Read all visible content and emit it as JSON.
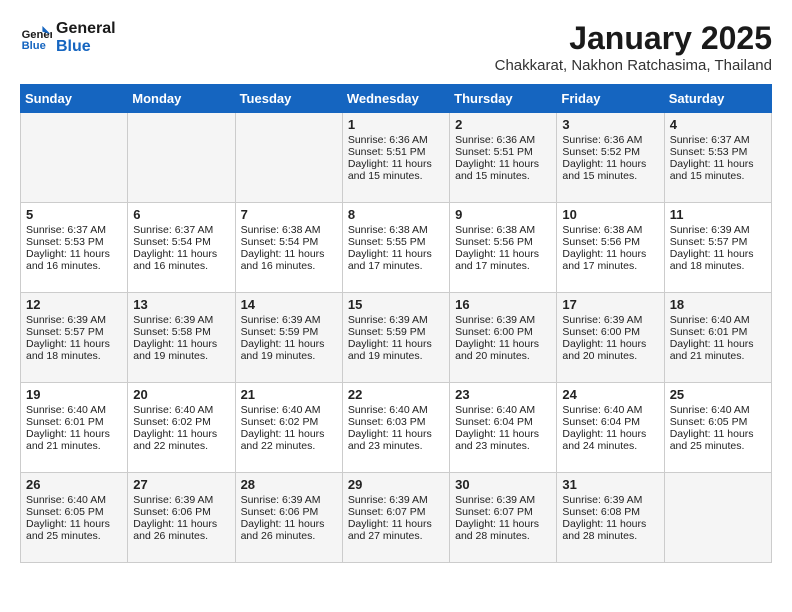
{
  "header": {
    "logo_line1": "General",
    "logo_line2": "Blue",
    "month": "January 2025",
    "location": "Chakkarat, Nakhon Ratchasima, Thailand"
  },
  "days_of_week": [
    "Sunday",
    "Monday",
    "Tuesday",
    "Wednesday",
    "Thursday",
    "Friday",
    "Saturday"
  ],
  "weeks": [
    [
      {
        "day": "",
        "info": ""
      },
      {
        "day": "",
        "info": ""
      },
      {
        "day": "",
        "info": ""
      },
      {
        "day": "1",
        "info": "Sunrise: 6:36 AM\nSunset: 5:51 PM\nDaylight: 11 hours and 15 minutes."
      },
      {
        "day": "2",
        "info": "Sunrise: 6:36 AM\nSunset: 5:51 PM\nDaylight: 11 hours and 15 minutes."
      },
      {
        "day": "3",
        "info": "Sunrise: 6:36 AM\nSunset: 5:52 PM\nDaylight: 11 hours and 15 minutes."
      },
      {
        "day": "4",
        "info": "Sunrise: 6:37 AM\nSunset: 5:53 PM\nDaylight: 11 hours and 15 minutes."
      }
    ],
    [
      {
        "day": "5",
        "info": "Sunrise: 6:37 AM\nSunset: 5:53 PM\nDaylight: 11 hours and 16 minutes."
      },
      {
        "day": "6",
        "info": "Sunrise: 6:37 AM\nSunset: 5:54 PM\nDaylight: 11 hours and 16 minutes."
      },
      {
        "day": "7",
        "info": "Sunrise: 6:38 AM\nSunset: 5:54 PM\nDaylight: 11 hours and 16 minutes."
      },
      {
        "day": "8",
        "info": "Sunrise: 6:38 AM\nSunset: 5:55 PM\nDaylight: 11 hours and 17 minutes."
      },
      {
        "day": "9",
        "info": "Sunrise: 6:38 AM\nSunset: 5:56 PM\nDaylight: 11 hours and 17 minutes."
      },
      {
        "day": "10",
        "info": "Sunrise: 6:38 AM\nSunset: 5:56 PM\nDaylight: 11 hours and 17 minutes."
      },
      {
        "day": "11",
        "info": "Sunrise: 6:39 AM\nSunset: 5:57 PM\nDaylight: 11 hours and 18 minutes."
      }
    ],
    [
      {
        "day": "12",
        "info": "Sunrise: 6:39 AM\nSunset: 5:57 PM\nDaylight: 11 hours and 18 minutes."
      },
      {
        "day": "13",
        "info": "Sunrise: 6:39 AM\nSunset: 5:58 PM\nDaylight: 11 hours and 19 minutes."
      },
      {
        "day": "14",
        "info": "Sunrise: 6:39 AM\nSunset: 5:59 PM\nDaylight: 11 hours and 19 minutes."
      },
      {
        "day": "15",
        "info": "Sunrise: 6:39 AM\nSunset: 5:59 PM\nDaylight: 11 hours and 19 minutes."
      },
      {
        "day": "16",
        "info": "Sunrise: 6:39 AM\nSunset: 6:00 PM\nDaylight: 11 hours and 20 minutes."
      },
      {
        "day": "17",
        "info": "Sunrise: 6:39 AM\nSunset: 6:00 PM\nDaylight: 11 hours and 20 minutes."
      },
      {
        "day": "18",
        "info": "Sunrise: 6:40 AM\nSunset: 6:01 PM\nDaylight: 11 hours and 21 minutes."
      }
    ],
    [
      {
        "day": "19",
        "info": "Sunrise: 6:40 AM\nSunset: 6:01 PM\nDaylight: 11 hours and 21 minutes."
      },
      {
        "day": "20",
        "info": "Sunrise: 6:40 AM\nSunset: 6:02 PM\nDaylight: 11 hours and 22 minutes."
      },
      {
        "day": "21",
        "info": "Sunrise: 6:40 AM\nSunset: 6:02 PM\nDaylight: 11 hours and 22 minutes."
      },
      {
        "day": "22",
        "info": "Sunrise: 6:40 AM\nSunset: 6:03 PM\nDaylight: 11 hours and 23 minutes."
      },
      {
        "day": "23",
        "info": "Sunrise: 6:40 AM\nSunset: 6:04 PM\nDaylight: 11 hours and 23 minutes."
      },
      {
        "day": "24",
        "info": "Sunrise: 6:40 AM\nSunset: 6:04 PM\nDaylight: 11 hours and 24 minutes."
      },
      {
        "day": "25",
        "info": "Sunrise: 6:40 AM\nSunset: 6:05 PM\nDaylight: 11 hours and 25 minutes."
      }
    ],
    [
      {
        "day": "26",
        "info": "Sunrise: 6:40 AM\nSunset: 6:05 PM\nDaylight: 11 hours and 25 minutes."
      },
      {
        "day": "27",
        "info": "Sunrise: 6:39 AM\nSunset: 6:06 PM\nDaylight: 11 hours and 26 minutes."
      },
      {
        "day": "28",
        "info": "Sunrise: 6:39 AM\nSunset: 6:06 PM\nDaylight: 11 hours and 26 minutes."
      },
      {
        "day": "29",
        "info": "Sunrise: 6:39 AM\nSunset: 6:07 PM\nDaylight: 11 hours and 27 minutes."
      },
      {
        "day": "30",
        "info": "Sunrise: 6:39 AM\nSunset: 6:07 PM\nDaylight: 11 hours and 28 minutes."
      },
      {
        "day": "31",
        "info": "Sunrise: 6:39 AM\nSunset: 6:08 PM\nDaylight: 11 hours and 28 minutes."
      },
      {
        "day": "",
        "info": ""
      }
    ]
  ]
}
